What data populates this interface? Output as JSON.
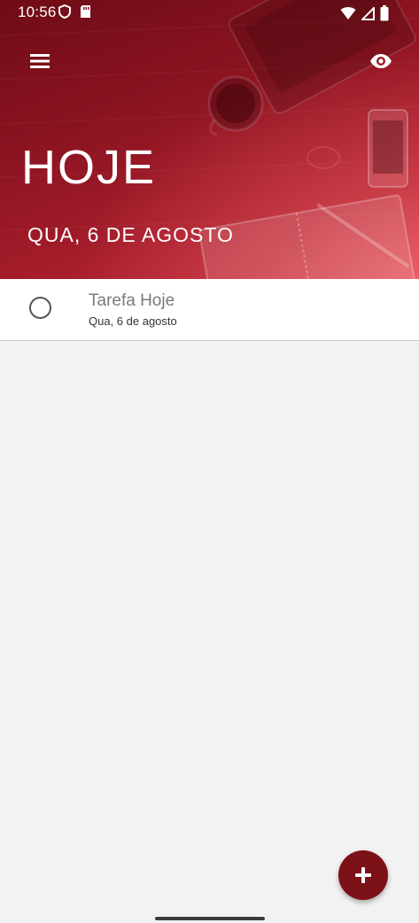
{
  "status_bar": {
    "time": "10:56",
    "left_icons": [
      "vpn-shield-icon",
      "sd-card-icon"
    ],
    "right_icons": [
      "wifi-icon",
      "cell-signal-icon",
      "battery-icon"
    ]
  },
  "toolbar": {
    "menu_icon": "hamburger-menu-icon",
    "visibility_icon": "eye-icon"
  },
  "header": {
    "title": "HOJE",
    "date": "QUA, 6 DE AGOSTO",
    "accent_color": "#8a1320"
  },
  "tasks": [
    {
      "title": "Tarefa Hoje",
      "date": "Qua, 6 de agosto",
      "completed": false
    }
  ],
  "fab": {
    "icon": "plus-icon",
    "color": "#7c1117"
  }
}
